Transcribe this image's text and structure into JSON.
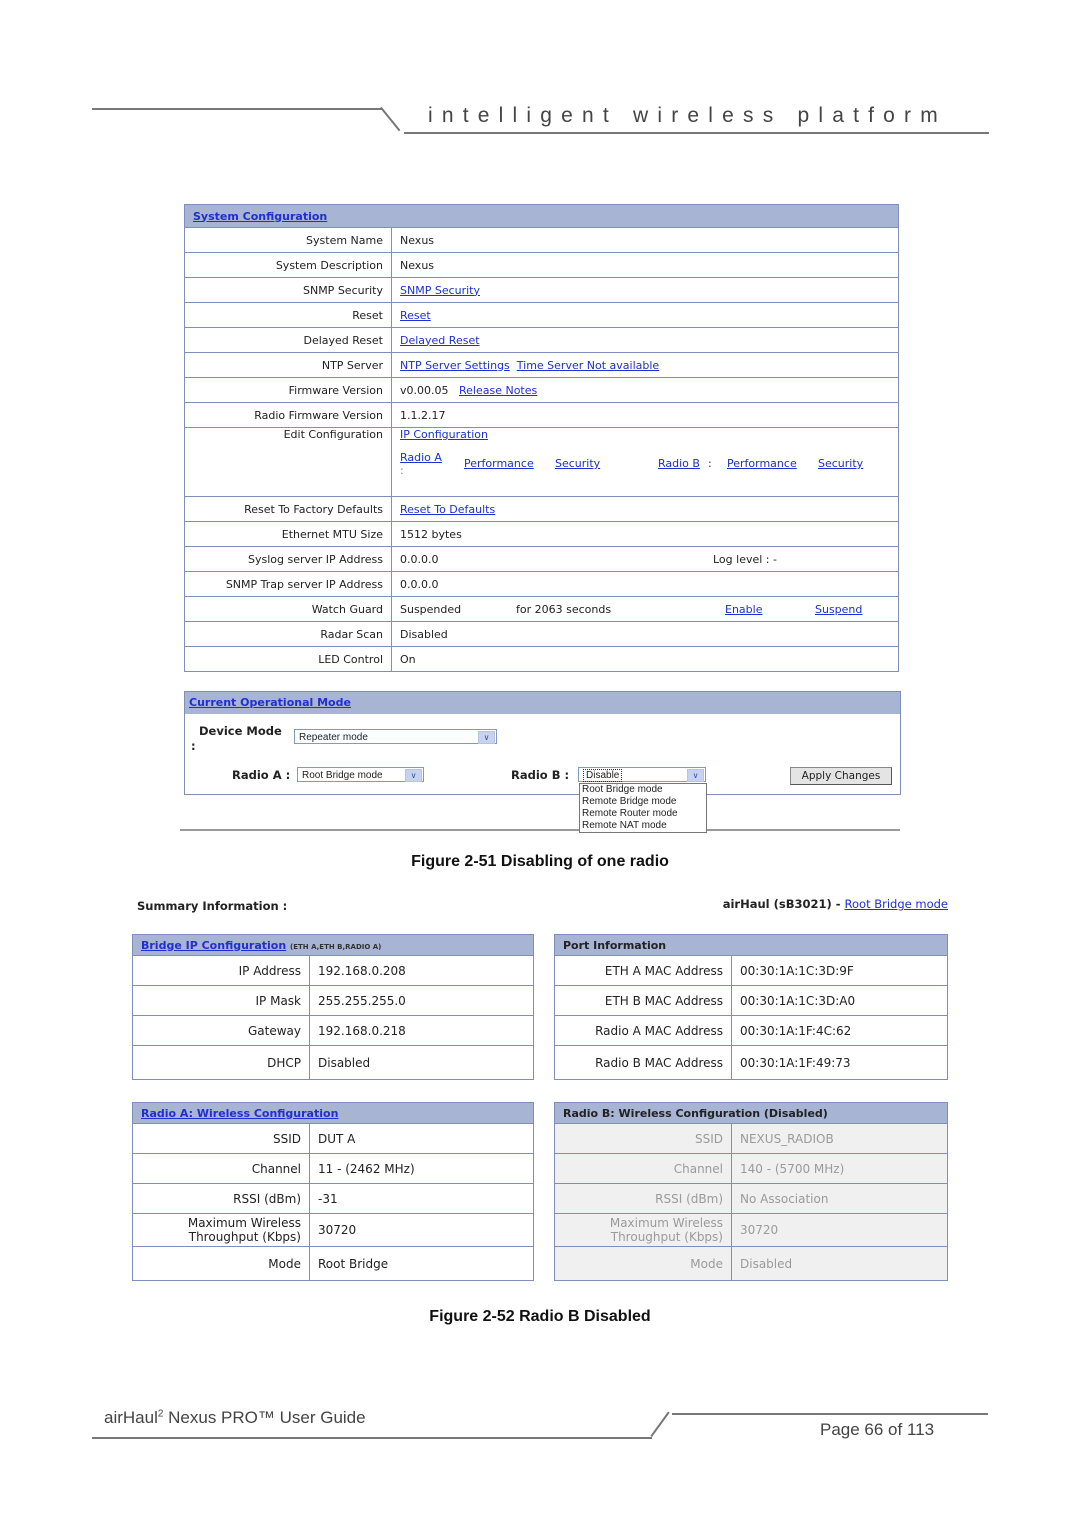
{
  "header": {
    "tagline": "intelligent wireless platform"
  },
  "system_config": {
    "title": "System Configuration",
    "rows": [
      {
        "label": "System Name",
        "value": "Nexus"
      },
      {
        "label": "System Description",
        "value": "Nexus"
      },
      {
        "label": "SNMP Security",
        "link": "SNMP Security"
      },
      {
        "label": "Reset",
        "link": "Reset"
      },
      {
        "label": "Delayed Reset",
        "link": "Delayed Reset"
      },
      {
        "label": "NTP Server",
        "link": "NTP Server Settings",
        "link2": "Time Server Not available"
      },
      {
        "label": "Firmware Version",
        "value": "v0.00.05",
        "link": "Release Notes"
      },
      {
        "label": "Radio Firmware Version",
        "value": "1.1.2.17"
      }
    ],
    "edit_config": {
      "label": "Edit Configuration",
      "ip_config": "IP Configuration",
      "radio_a": "Radio A",
      "radio_a_colon": ":",
      "radio_a_performance": "Performance",
      "radio_a_security": "Security",
      "radio_b": "Radio B",
      "radio_b_colon": ":",
      "radio_b_performance": "Performance",
      "radio_b_security": "Security"
    },
    "rows2": [
      {
        "label": "Reset To Factory Defaults",
        "link": "Reset To Defaults"
      },
      {
        "label": "Ethernet MTU Size",
        "value": "1512 bytes"
      },
      {
        "label": "Syslog server IP Address",
        "value": "0.0.0.0",
        "extra": "Log level : -"
      },
      {
        "label": "SNMP Trap server IP Address",
        "value": "0.0.0.0"
      },
      {
        "label": "Watch Guard",
        "value": "Suspended",
        "extra": "for 2063 seconds",
        "link": "Enable",
        "link2": "Suspend"
      },
      {
        "label": "Radar Scan",
        "value": "Disabled"
      },
      {
        "label": "LED Control",
        "value": "On"
      }
    ]
  },
  "op_mode": {
    "title": "Current Operational Mode",
    "device_mode_label": "Device Mode",
    "device_mode_colon": ":",
    "device_mode_value": "Repeater mode",
    "radio_a_label": "Radio A :",
    "radio_a_value": "Root Bridge mode",
    "radio_b_label": "Radio B :",
    "radio_b_value": "Disable",
    "radio_b_options": [
      "Root Bridge mode",
      "Remote Bridge mode",
      "Remote Router mode",
      "Remote NAT mode"
    ],
    "apply_label": "Apply Changes",
    "arrow_glyph": "∨"
  },
  "captions": {
    "fig51": "Figure 2-51 Disabling of one radio",
    "fig52": "Figure 2-52 Radio B Disabled"
  },
  "summary": {
    "title": "Summary Information :",
    "device": "airHaul (sB3021) -",
    "device_mode_link": "Root Bridge mode",
    "bridge_ip": {
      "title": "Bridge IP Configuration",
      "note": "(ETH A,ETH B,RADIO A)",
      "rows": [
        {
          "label": "IP Address",
          "value": "192.168.0.208"
        },
        {
          "label": "IP Mask",
          "value": "255.255.255.0"
        },
        {
          "label": "Gateway",
          "value": "192.168.0.218"
        },
        {
          "label": "DHCP",
          "value": "Disabled"
        }
      ]
    },
    "port_info": {
      "title": "Port Information",
      "rows": [
        {
          "label": "ETH A MAC Address",
          "value": "00:30:1A:1C:3D:9F"
        },
        {
          "label": "ETH B MAC Address",
          "value": "00:30:1A:1C:3D:A0"
        },
        {
          "label": "Radio A MAC Address",
          "value": "00:30:1A:1F:4C:62"
        },
        {
          "label": "Radio B MAC Address",
          "value": "00:30:1A:1F:49:73"
        }
      ]
    },
    "radio_a": {
      "title": "Radio A: Wireless Configuration",
      "rows": [
        {
          "label": "SSID",
          "value": "DUT A"
        },
        {
          "label": "Channel",
          "value": "11 - (2462 MHz)"
        },
        {
          "label": "RSSI (dBm)",
          "value": "-31"
        },
        {
          "label_l1": "Maximum Wireless",
          "label_l2": "Throughput (Kbps)",
          "value": "30720"
        },
        {
          "label": "Mode",
          "value": "Root Bridge"
        }
      ]
    },
    "radio_b": {
      "title": "Radio B: Wireless Configuration (Disabled)",
      "rows": [
        {
          "label": "SSID",
          "value": "NEXUS_RADIOB"
        },
        {
          "label": "Channel",
          "value": "140 - (5700 MHz)"
        },
        {
          "label": "RSSI (dBm)",
          "value": "No Association"
        },
        {
          "label_l1": "Maximum Wireless",
          "label_l2": "Throughput (Kbps)",
          "value": "30720"
        },
        {
          "label": "Mode",
          "value": "Disabled"
        }
      ]
    }
  },
  "footer": {
    "guide_pre": "airHaul",
    "guide_sup": "2",
    "guide_post": " Nexus PRO™ User Guide",
    "page": "Page 66 of 113"
  },
  "colors": {
    "panel_header": "#a7b4d3",
    "panel_border": "#7e8fbd",
    "link": "#1f2fd0",
    "disabled_text": "#9a9a9a"
  }
}
